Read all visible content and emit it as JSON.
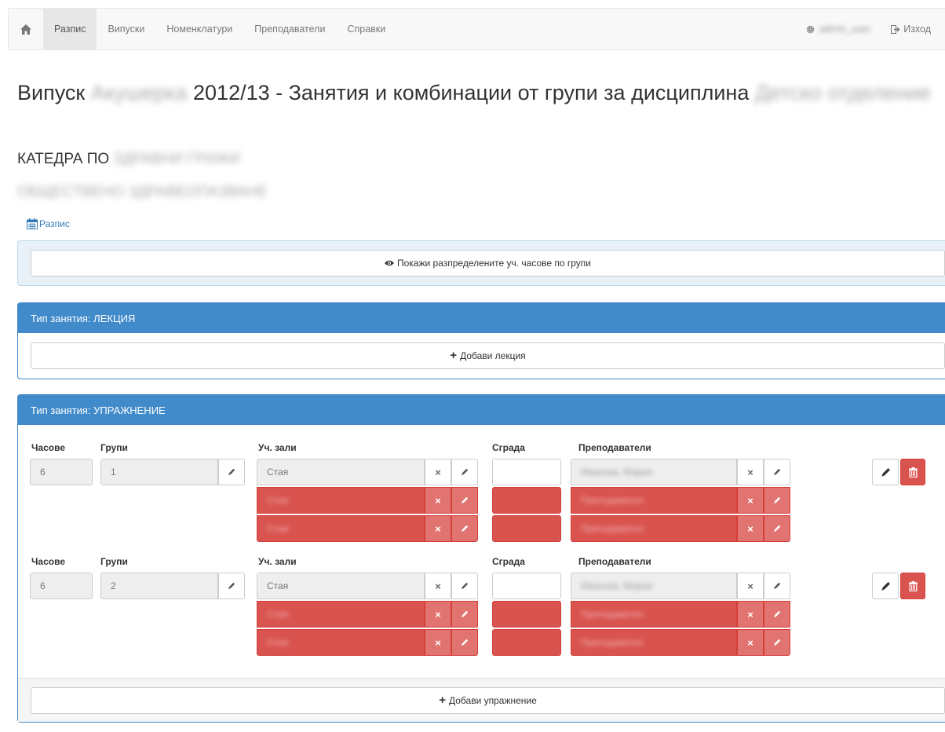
{
  "nav": {
    "items": [
      "Разпис",
      "Випуски",
      "Номенклатури",
      "Преподаватели",
      "Справки"
    ],
    "user_name": "admin_user",
    "logout_label": "Изход"
  },
  "page": {
    "title_prefix": "Випуск",
    "title_program": "Акушерка",
    "title_middle": "2012/13 - Занятия и комбинации от групи за дисциплина",
    "title_discipline": "Детско отделение",
    "dept_prefix": "КАТЕДРА ПО",
    "dept_name": "ЗДРАВНИ ГРИЖИ",
    "dept_line2": "ОБЩЕСТВЕНО ЗДРАВЕОПАЗВАНЕ",
    "schedule_link": "Разпис",
    "show_hours_label": "Покажи разпределените уч. часове по групи"
  },
  "lecture_panel": {
    "title": "Тип занятия: ЛЕКЦИЯ",
    "add_label": "Добави лекция"
  },
  "exercise_panel": {
    "title": "Тип занятия: УПРАЖНЕНИЕ",
    "add_label": "Добави упражнение",
    "labels": {
      "hours": "Часове",
      "groups": "Групи",
      "rooms": "Уч. зали",
      "building": "Сграда",
      "teachers": "Преподаватели"
    },
    "rows": [
      {
        "hours": "6",
        "group": "1",
        "room": "Стая",
        "room_extra": [
          "Стая",
          "Стая"
        ],
        "teacher": "Иванова, Мария",
        "teacher_extra": [
          "Преподавател",
          "Преподавател"
        ]
      },
      {
        "hours": "6",
        "group": "2",
        "room": "Стая",
        "room_extra": [
          "Стая",
          "Стая"
        ],
        "teacher": "Иванова, Мария",
        "teacher_extra": [
          "Преподавател",
          "Преподавател"
        ]
      }
    ]
  }
}
